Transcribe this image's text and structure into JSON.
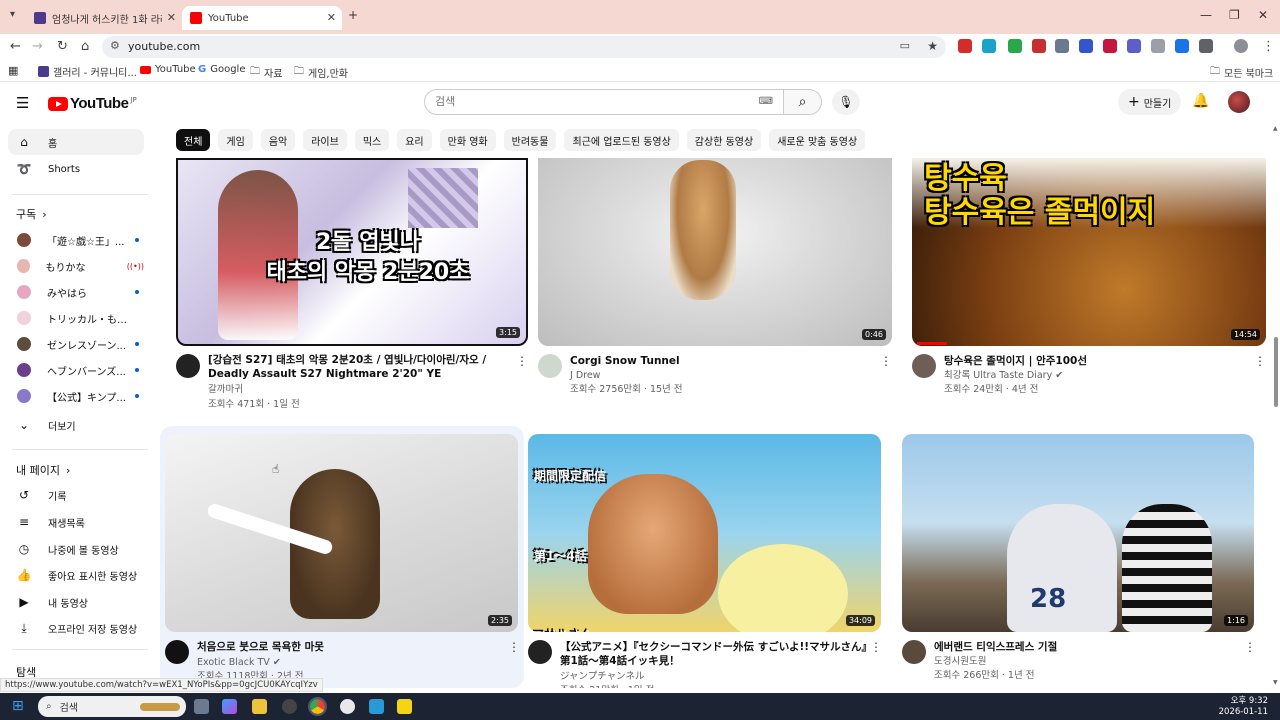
{
  "browser": {
    "tabs": [
      {
        "title": "엄청나게 허스키한 1화 라라 -",
        "active": false
      },
      {
        "title": "YouTube",
        "active": true
      }
    ],
    "url": "youtube.com",
    "bookmarks": [
      "갤러리 - 커뮤니티...",
      "YouTube",
      "Google",
      "자료",
      "게임,만화"
    ],
    "all_bookmarks": "모든 북마크"
  },
  "header": {
    "logo_text": "YouTube",
    "logo_region": "JP",
    "search_placeholder": "검색",
    "create_label": "만들기"
  },
  "sidebar": {
    "main": [
      {
        "label": "홈",
        "icon": "home-icon",
        "active": true
      },
      {
        "label": "Shorts",
        "icon": "shorts-icon",
        "active": false
      }
    ],
    "subscriptions_heading": "구독",
    "subscriptions": [
      {
        "label": "「遊☆戯☆王」...",
        "status": "new"
      },
      {
        "label": "もりかな",
        "status": "live"
      },
      {
        "label": "みやはら",
        "status": "new"
      },
      {
        "label": "トリッカル・もち...",
        "status": "none"
      },
      {
        "label": "ゼンレスゾーン...",
        "status": "new"
      },
      {
        "label": "ヘブンバーンズ...",
        "status": "new"
      },
      {
        "label": "【公式】キンプ...",
        "status": "new"
      }
    ],
    "more_label": "더보기",
    "you_heading": "내 페이지",
    "you_items": [
      {
        "label": "기록",
        "icon": "history-icon"
      },
      {
        "label": "재생목록",
        "icon": "playlists-icon"
      },
      {
        "label": "나중에 볼 동영상",
        "icon": "watch-later-icon"
      },
      {
        "label": "좋아요 표시한 동영상",
        "icon": "like-icon"
      },
      {
        "label": "내 동영상",
        "icon": "my-videos-icon"
      },
      {
        "label": "오프라인 저장 동영상",
        "icon": "download-icon"
      }
    ],
    "explore_heading": "탐색"
  },
  "chips": [
    "전체",
    "게임",
    "음악",
    "라이브",
    "믹스",
    "요리",
    "만화 영화",
    "반려동물",
    "최근에 업로드된 동영상",
    "감상한 동영상",
    "새로운 맞춤 동영상"
  ],
  "videos": [
    {
      "title": "[강습전 S27] 태초의 악몽 2분20초 / 엽빛나/다이아린/자오 / Deadly Assault S27 Nightmare 2'20\" YE SHUNGUANG/DIALYN/ZHAO",
      "channel": "갈까마귀",
      "verified": false,
      "stats": "조회수 471회 · 1일 전",
      "duration": "3:15",
      "thumb_text": "2돌 엽빛나\n태초의 악몽 2분20초"
    },
    {
      "title": "Corgi Snow Tunnel",
      "channel": "J Drew",
      "verified": false,
      "stats": "조회수 2756만회 · 15년 전",
      "duration": "0:46",
      "thumb_text": ""
    },
    {
      "title": "탕수육은 졸먹이지 | 안주100선",
      "channel": "최강록 Ultra Taste Diary",
      "verified": true,
      "stats": "조회수 24만회 · 4년 전",
      "duration": "14:54",
      "thumb_text": "탕수육\n탕수육은 졸먹이지"
    },
    {
      "title": "처음으로 붓으로 목욕한 마못",
      "channel": "Exotic Black TV",
      "verified": true,
      "stats": "조회수 1118만회 · 2년 전",
      "duration": "2:35",
      "thumb_text": ""
    },
    {
      "title": "【公式アニメ】『セクシーコマンドー外伝 すごいよ!!マサルさん』第1話〜第4話イッキ見！",
      "channel": "ジャンプチャンネル",
      "verified": false,
      "stats": "조회수 21만회 · 1일 전",
      "duration": "34:09",
      "thumb_text": "期間限定配信\n第1〜4話\nマサルさん"
    },
    {
      "title": "에버랜드 티익스프레스 기절",
      "channel": "도경시원도원",
      "verified": false,
      "stats": "조회수 266만회 · 1년 전",
      "duration": "1:16",
      "thumb_text": "28"
    }
  ],
  "status_url": "https://www.youtube.com/watch?v=wEX1_NYoPIs&pp=0gcJCU0KAYcqIYzv",
  "taskbar": {
    "search_placeholder": "검색",
    "time": "오후 9:32",
    "date": "2026-01-11"
  },
  "colors": {
    "brand": "#ff0000",
    "tabbar": "#f6d8d3",
    "taskbar": "#1c2433"
  }
}
